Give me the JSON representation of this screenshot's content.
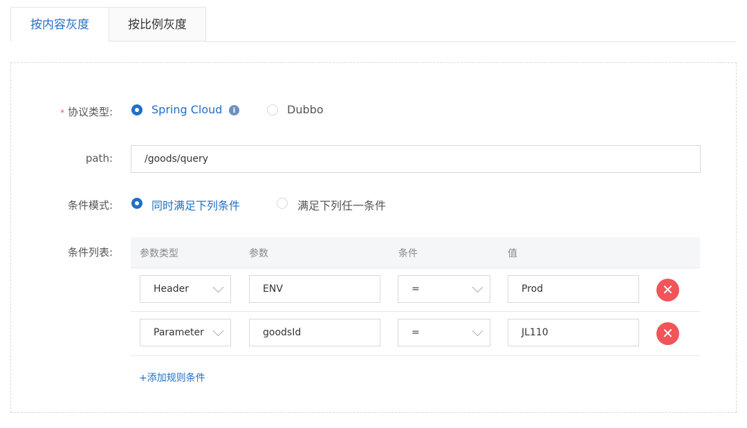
{
  "tabs": [
    {
      "label": "按内容灰度",
      "active": true
    },
    {
      "label": "按比例灰度",
      "active": false
    }
  ],
  "form": {
    "protocol": {
      "required_mark": "*",
      "label": "协议类型:",
      "options": [
        "Spring Cloud",
        "Dubbo"
      ],
      "selected": "Spring Cloud",
      "info_icon": "info-icon"
    },
    "path": {
      "label": "path:",
      "value": "/goods/query"
    },
    "mode": {
      "label": "条件模式:",
      "options": [
        "同时满足下列条件",
        "满足下列任一条件"
      ],
      "selected": "同时满足下列条件"
    },
    "conditions": {
      "label": "条件列表:",
      "headers": [
        "参数类型",
        "参数",
        "条件",
        "值"
      ],
      "rows": [
        {
          "type": "Header",
          "param": "ENV",
          "op": "=",
          "value": "Prod"
        },
        {
          "type": "Parameter",
          "param": "goodsId",
          "op": "=",
          "value": "JL110"
        }
      ],
      "add_label": "+添加规则条件"
    }
  },
  "colors": {
    "accent": "#1f6fc5",
    "danger": "#f0555a"
  }
}
